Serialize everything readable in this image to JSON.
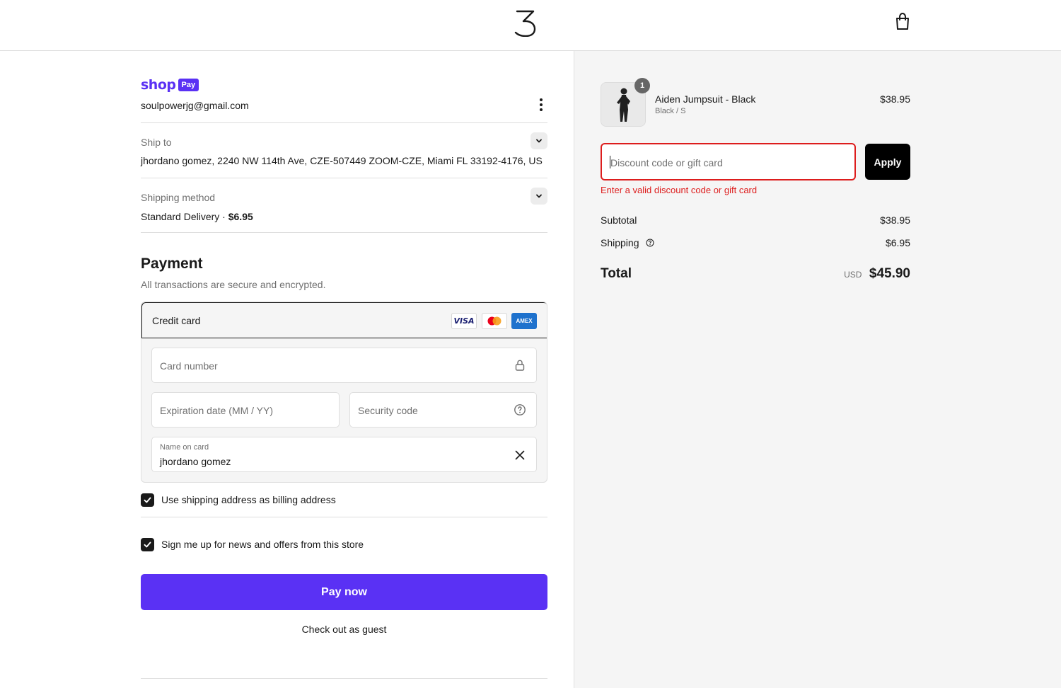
{
  "colors": {
    "brand": "#5a31f4",
    "error": "#dd1d1d",
    "text": "#1a1a1a",
    "muted": "#707070",
    "summary_bg": "#f5f5f5"
  },
  "header": {
    "logo_icon": "store-logo-icon",
    "cart_icon": "shopping-bag-icon"
  },
  "shop_pay": {
    "word": "shop",
    "badge": "Pay",
    "email": "soulpowerjg@gmail.com",
    "menu_icon": "kebab-menu-icon"
  },
  "ship_to": {
    "label": "Ship to",
    "value": "jhordano gomez, 2240 NW 114th Ave, CZE-507449 ZOOM-CZE, Miami FL 33192-4176, US"
  },
  "shipping_method": {
    "label": "Shipping method",
    "name": "Standard Delivery",
    "separator": "·",
    "price": "$6.95"
  },
  "payment": {
    "title": "Payment",
    "subtitle": "All transactions are secure and encrypted.",
    "method_label": "Credit card",
    "card_logos": [
      "VISA",
      "mastercard",
      "AMEX"
    ],
    "fields": {
      "card_number_placeholder": "Card number",
      "expiration_placeholder": "Expiration date (MM / YY)",
      "security_code_placeholder": "Security code",
      "name_label": "Name on card",
      "name_value": "jhordano gomez"
    }
  },
  "options": {
    "billing_same": "Use shipping address as billing address",
    "newsletter": "Sign me up for news and offers from this store"
  },
  "actions": {
    "pay_now": "Pay now",
    "guest": "Check out as guest"
  },
  "summary": {
    "item": {
      "quantity": "1",
      "name": "Aiden Jumpsuit - Black",
      "variant": "Black / S",
      "price": "$38.95"
    },
    "discount": {
      "placeholder": "Discount code or gift card",
      "apply": "Apply",
      "error": "Enter a valid discount code or gift card"
    },
    "subtotal_label": "Subtotal",
    "subtotal_value": "$38.95",
    "shipping_label": "Shipping",
    "shipping_value": "$6.95",
    "total_label": "Total",
    "total_currency": "USD",
    "total_value": "$45.90"
  }
}
